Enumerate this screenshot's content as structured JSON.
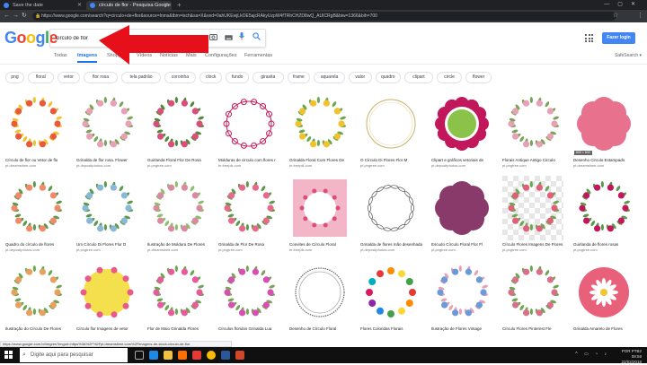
{
  "browser": {
    "tabs": [
      {
        "label": "Save the date"
      },
      {
        "label": "círculo de flor - Pesquisa Google"
      }
    ],
    "new_tab_icon": "plus-icon",
    "url": "https://www.google.com/search?q=circulo+de+flor&source=lnms&tbm=isch&sa=X&ved=0ahUKEwjLkOE5ajcRAkyUzpW4fTRhCHZD8wQ_AUICRgB&biw=1366&bih=700"
  },
  "google": {
    "logo_letters": [
      {
        "ch": "G",
        "color": "#4285f4"
      },
      {
        "ch": "o",
        "color": "#ea4335"
      },
      {
        "ch": "o",
        "color": "#fbbc05"
      },
      {
        "ch": "g",
        "color": "#4285f4"
      },
      {
        "ch": "l",
        "color": "#34a853"
      },
      {
        "ch": "e",
        "color": "#ea4335"
      }
    ],
    "query": "círculo de flor",
    "signin_label": "Fazer login",
    "safe_search": "SafeSearch ▾"
  },
  "nav_tabs": [
    "Todas",
    "Imagens",
    "Shopping",
    "Vídeos",
    "Notícias",
    "Mais",
    "Configurações",
    "Ferramentas"
  ],
  "active_tab_index": 1,
  "chips": [
    "png",
    "floral",
    "vetor",
    "flor rosa",
    "tela padrão",
    "coroinha",
    "clock",
    "fundo",
    "girasita",
    "frame",
    "aquarela",
    "valor",
    "quadro",
    "clipart",
    "circle",
    "flower"
  ],
  "results": [
    {
      "caption": "Círculo de flor ou Vetor de flo",
      "source": "pt.dreamstime.com",
      "style": "wreath",
      "color": "#e85a3a",
      "accent": "#f2c12e"
    },
    {
      "caption": "Grinalda de flor rosa. Flower",
      "source": "pt.depositphotos.com",
      "style": "wreath",
      "color": "#e8a0b4",
      "accent": "#7aa35a"
    },
    {
      "caption": "Guirlanda Floral Flor De Rosa",
      "source": "pt.pngtree.com",
      "style": "wreath",
      "color": "#d94f7a",
      "accent": "#4f8a3a"
    },
    {
      "caption": "Molduras de circulo com flores r",
      "source": "br.freepik.com",
      "style": "scroll",
      "color": "#c2185b",
      "accent": "#e0e0e0"
    },
    {
      "caption": "Grinalda Floral Com Flores De",
      "source": "br.freepik.com",
      "style": "wreath",
      "color": "#f2c12e",
      "accent": "#6aa84f"
    },
    {
      "caption": "O Círculo Di Flores Flor M",
      "source": "pt.pngtree.com",
      "style": "thin",
      "color": "#c9b26a",
      "accent": "#e8d9a8"
    },
    {
      "caption": "Clipart e gráficos vetoriais de",
      "source": "pt.depositphotos.com",
      "style": "scallop",
      "color": "#c2185b",
      "accent": "#8bc34a"
    },
    {
      "caption": "Florais Antique Antigo Circulo",
      "source": "pt.pngtree.com",
      "style": "wreath",
      "color": "#e8a0b4",
      "accent": "#7aa35a"
    },
    {
      "caption": "Desenho Circulo Estampado",
      "source": "pt.dreamstime.com",
      "style": "flowerfill",
      "color": "#e8728e",
      "accent": "#f5f5f5",
      "badge": "600 × 600"
    },
    {
      "caption": "Quadro do círculo de flores",
      "source": "pt.depositphotos.com",
      "style": "wreath",
      "color": "#f08a6a",
      "accent": "#5a9a4a"
    },
    {
      "caption": "Um Círculo Di Flores Flor D",
      "source": "pt.pngtree.com",
      "style": "wreath",
      "color": "#8ab8d8",
      "accent": "#5a9a4a"
    },
    {
      "caption": "Ilustração de Moldura De Flores",
      "source": "pt.dreamstime.com",
      "style": "wreath",
      "color": "#d98aa0",
      "accent": "#8abf6a"
    },
    {
      "caption": "Grinalda de Flor De Rosa",
      "source": "pt.pngtree.com",
      "style": "wreath",
      "color": "#e86a8a",
      "accent": "#5a9a4a"
    },
    {
      "caption": "Convites de Círculo Floral",
      "source": "br.freepik.com",
      "style": "pinkcard",
      "color": "#f2b6c8",
      "accent": "#d94f7a"
    },
    {
      "caption": "Grinalda de flores mão desenhada",
      "source": "pt.depositphotos.com",
      "style": "ink",
      "color": "#555555",
      "accent": "#999999"
    },
    {
      "caption": "Escudo Círculo Floral Flor Fl",
      "source": "pt.pngtree.com",
      "style": "flowerfill",
      "color": "#8a3a6a",
      "accent": "#ffffff"
    },
    {
      "caption": "Círculo Flores Imagens De Flores",
      "source": "pt.pngtree.com",
      "style": "wreath",
      "color": "#e0607a",
      "accent": "#6aa84f",
      "checker": true
    },
    {
      "caption": "Guirlanda de flores rosas",
      "source": "pt.pngtree.com",
      "style": "wreath",
      "color": "#c2185b",
      "accent": "#5a9a4a"
    },
    {
      "caption": "Ilustração do Círculo De Flores",
      "source": "pt.dreamstime.com",
      "style": "wreath",
      "color": "#e8a060",
      "accent": "#6aa84f"
    },
    {
      "caption": "Círculo flor Imagens de vetor",
      "source": "pt.depositphotos.com",
      "style": "yellowdisc",
      "color": "#f4e04d",
      "accent": "#e85a8a"
    },
    {
      "caption": "Flor de Maio Grinalda Flores",
      "source": "pt.dreamstime.com",
      "style": "wreath",
      "color": "#e85a9a",
      "accent": "#6aa84f"
    },
    {
      "caption": "Círculos floridos Grinalda Lua",
      "source": "pt.pngtree.com",
      "style": "wreath",
      "color": "#d94fb0",
      "accent": "#7aa35a"
    },
    {
      "caption": "Desenho de Círculo Floral",
      "source": "pt.pngtree.com",
      "style": "doublering",
      "color": "#666666",
      "accent": "#aaaaaa"
    },
    {
      "caption": "Flores Coloridas Florais",
      "source": "pt.depositphotos.com",
      "style": "dots",
      "color": "#e53935",
      "accent": "#43a047"
    },
    {
      "caption": "Ilustração de Flores Vintage",
      "source": "pt.dreamstime.com",
      "style": "wreath",
      "color": "#6a9ad8",
      "accent": "#e8a0b4"
    },
    {
      "caption": "Círculo Flores Pinterest Fle",
      "source": "pt.pngtree.com",
      "style": "wreath",
      "color": "#d9708a",
      "accent": "#6aa84f"
    },
    {
      "caption": "Grinalda Amarelo de Flores",
      "source": "br.freepik.com",
      "style": "daisy",
      "color": "#e8607a",
      "accent": "#ffffff"
    },
    {
      "caption": "Grinalda de margarida floral",
      "source": "pt.depositphotos.com",
      "style": "wreath",
      "color": "#f4d03f",
      "accent": "#7aa35a"
    }
  ],
  "status_url": "https://www.google.com.br/imgres?imgurl=https%3A%2F%2Fpt.dreamstime.com%2Fimagens-de-stock-circulo-de-flor",
  "taskbar": {
    "search_placeholder": "Digite aqui para pesquisar",
    "lang": "POR PTB2",
    "time": "08:59",
    "date": "22/02/2018"
  }
}
